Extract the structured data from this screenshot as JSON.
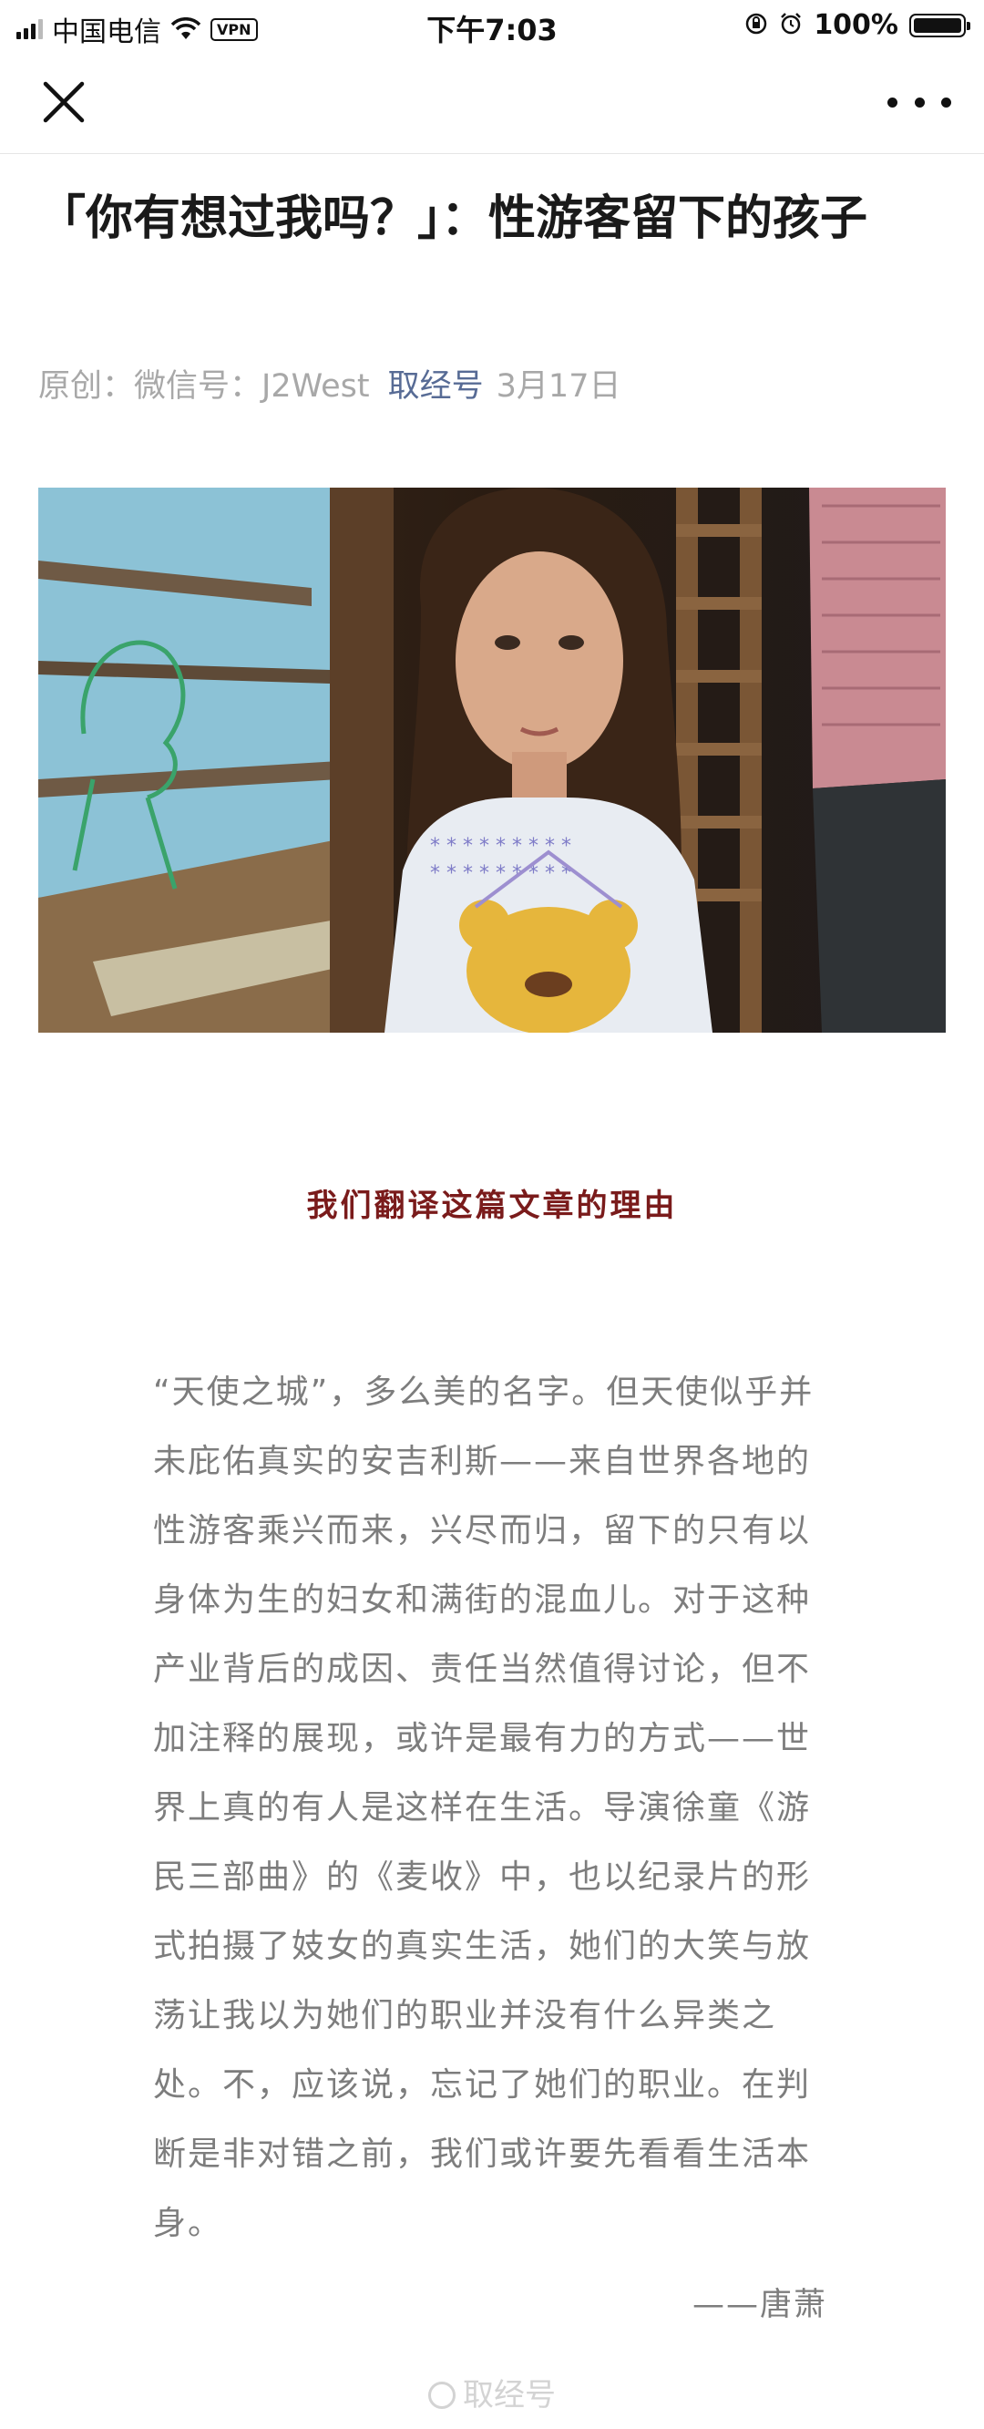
{
  "status_bar": {
    "carrier": "中国电信",
    "vpn": "VPN",
    "time": "下午7:03",
    "battery": "100%"
  },
  "nav": {
    "close_icon": "close-icon",
    "more_icon": "more-icon"
  },
  "article": {
    "title": "「你有想过我吗？」：性游客留下的孩子",
    "meta": {
      "prefix": "原创：微信号：J2West",
      "account": "取经号",
      "date": "3月17日"
    },
    "section_heading": "我们翻译这篇文章的理由",
    "intro": "“天使之城”，多么美的名字。但天使似乎并未庇佑真实的安吉利斯——来自世界各地的性游客乘兴而来，兴尽而归，留下的只有以身体为生的妇女和满街的混血儿。对于这种产业背后的成因、责任当然值得讨论，但不加注释的展现，或许是最有力的方式——世界上真的有人是这样在生活。导演徐童《游民三部曲》的《麦收》中，也以纪录片的形式拍摄了妓女的真实生活，她们的大笑与放荡让我以为她们的职业并没有什么异类之处。不，应该说，忘记了她们的职业。在判断是非对错之前，我们或许要先看看生活本身。",
    "signature": "——唐萧",
    "watermark": "取经号"
  },
  "colors": {
    "accent_link": "#576b95",
    "heading": "#7a1b1b",
    "body_text": "#7d7d7d"
  }
}
